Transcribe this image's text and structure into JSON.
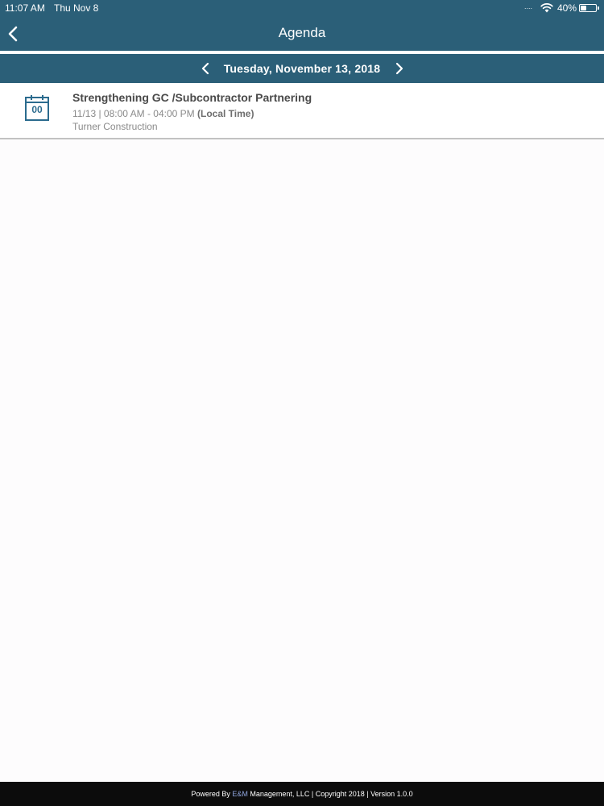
{
  "status_bar": {
    "time": "11:07 AM",
    "date": "Thu Nov 8",
    "signal_dots": "....",
    "battery_percent": "40%",
    "battery_level": 0.4
  },
  "nav": {
    "back_icon": "chevron-left-icon",
    "title": "Agenda"
  },
  "date_selector": {
    "prev_icon": "chevron-left-icon",
    "label": "Tuesday,  November  13, 2018",
    "next_icon": "chevron-right-icon"
  },
  "agenda_items": [
    {
      "icon": "calendar-icon",
      "icon_day": "00",
      "title": "Strengthening GC /Subcontractor Partnering",
      "time": "11/13 | 08:00 AM - 04:00 PM",
      "time_suffix": "(Local Time)",
      "organizer": "Turner Construction"
    }
  ],
  "footer": {
    "prefix": "Powered By ",
    "brand": "E&M",
    "suffix": " Management, LLC | Copyright 2018 | Version 1.0.0"
  },
  "colors": {
    "header": "#2b5f78",
    "accent_icon": "#2b6b8e",
    "footer_bg": "#0c0c0c",
    "footer_brand": "#8fa5dd"
  }
}
